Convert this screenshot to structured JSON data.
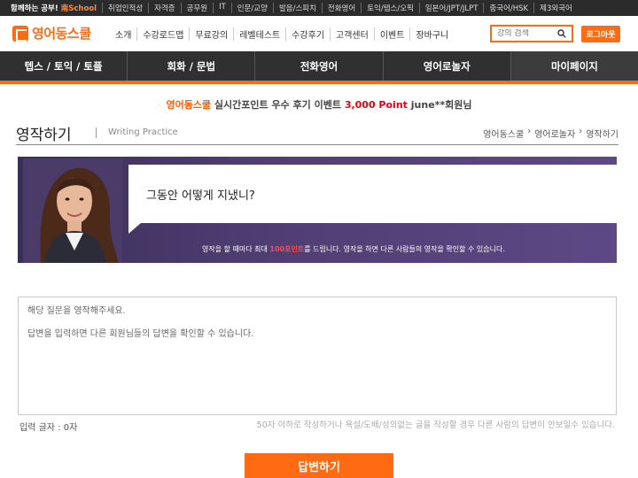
{
  "family_bar": {
    "intro": "함께하는 공부!",
    "intro_brand": "南School",
    "sites": [
      "취업인적성",
      "자격증",
      "공무원",
      "IT",
      "인문/교양",
      "발음/스피치",
      "전화영어",
      "토익/텝스/오픽",
      "일본어/JPT/JLPT",
      "중국어/HSK",
      "제3외국어"
    ]
  },
  "header": {
    "logo_text": "영어동스쿨",
    "menu": [
      "소개",
      "수강로드맵",
      "무료강의",
      "레벨테스트",
      "수강후기",
      "고객센터",
      "이벤트",
      "장바구니"
    ],
    "search_placeholder": "강의 검색",
    "logout_label": "로그아웃"
  },
  "main_nav": [
    "텝스 / 토익 / 토플",
    "회화 / 문법",
    "전화영어",
    "영어로놀자",
    "마이페이지"
  ],
  "event_banner": {
    "brand": "영어동스쿨",
    "text1": "실시간포인트 우수 후기 이벤트",
    "points": "3,000 Point",
    "text2": "june**회원님"
  },
  "page": {
    "title": "영작하기",
    "subtitle": "Writing Practice",
    "breadcrumb": [
      "영어동스쿨",
      "영어로놀자",
      "영작하기"
    ]
  },
  "question": {
    "text": "그동안 어떻게 지냈니?",
    "info_pre": "영작을 할 때마다 최대",
    "info_points": "100포인트",
    "info_post": "를 드립니다. 영작을 하면 다른 사람들의 영작을 확인할 수 있습니다."
  },
  "answer": {
    "placeholder_line1": "해당 질문을 영작해주세요.",
    "placeholder_line2": "답변을 입력하면 다른 회원님들의 답변을 확인할 수 있습니다.",
    "count_label": "입력 글자 : 0자",
    "notice": "50자 이하로 작성하거나 욕설/도배/성의없는 글을 작성할 경우 다른 사람의 답변이 안보일수 있습니다.",
    "submit_label": "답변하기"
  },
  "colors": {
    "accent": "#ff6a13",
    "nav_bg": "#303030",
    "question_bg": "#4f3d72"
  }
}
